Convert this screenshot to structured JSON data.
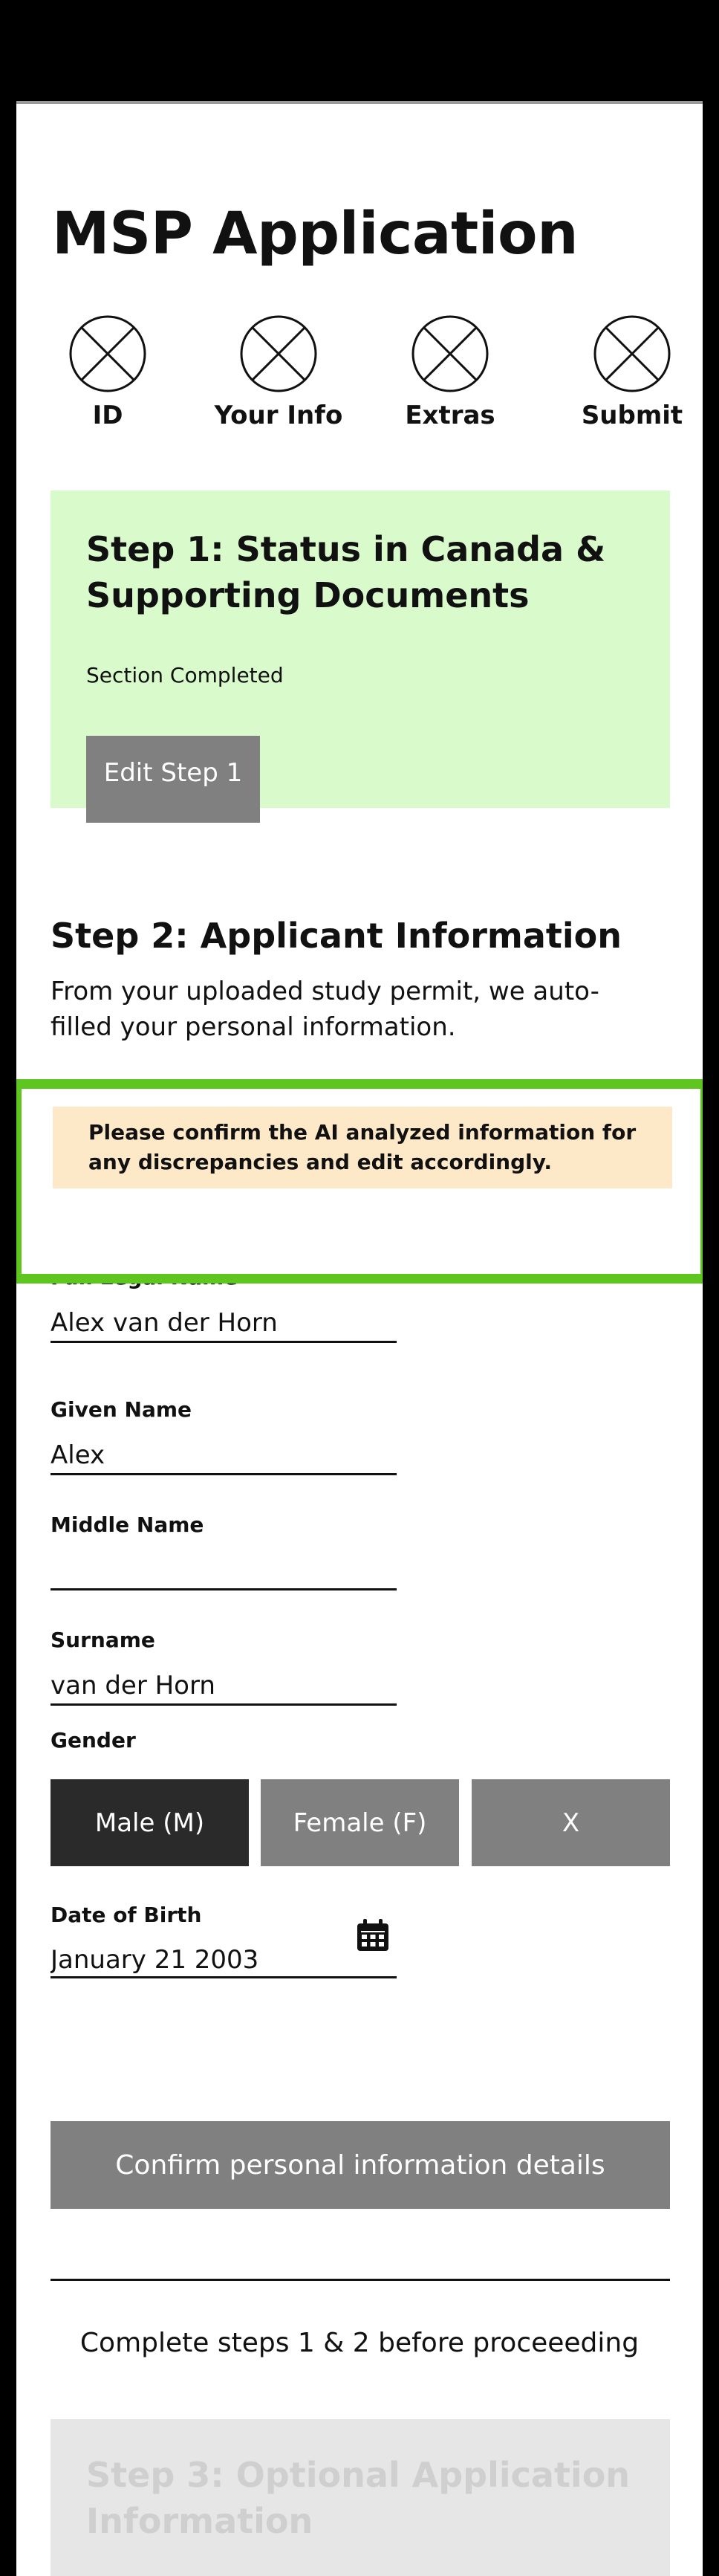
{
  "app": {
    "title": "MSP Application"
  },
  "stepper": {
    "steps": [
      {
        "label": "ID",
        "icon": "x-circle-icon"
      },
      {
        "label": "Your Info",
        "icon": "x-circle-icon"
      },
      {
        "label": "Extras",
        "icon": "x-circle-icon"
      },
      {
        "label": "Submit",
        "icon": "x-circle-icon"
      }
    ]
  },
  "step1": {
    "title": "Step 1: Status in Canada & Supporting Documents",
    "status": "Section Completed",
    "edit_label": "Edit Step 1"
  },
  "step2": {
    "title": "Step 2: Applicant Information",
    "description": "From your uploaded study permit, we auto-filled your personal information.",
    "alert": "Please confirm the AI analyzed information for any discrepancies and edit accordingly.",
    "fields": {
      "full_legal_name": {
        "label": "Full Legal Name",
        "value": "Alex van der Horn"
      },
      "given_name": {
        "label": "Given Name",
        "value": "Alex"
      },
      "middle_name": {
        "label": "Middle Name",
        "value": ""
      },
      "surname": {
        "label": "Surname",
        "value": "van der Horn"
      },
      "date_of_birth": {
        "label": "Date of Birth",
        "value": "January 21 2003"
      }
    },
    "gender": {
      "label": "Gender",
      "options": [
        "Male (M)",
        "Female (F)",
        "X"
      ],
      "selected": "Male (M)"
    },
    "confirm_label": "Confirm personal information details"
  },
  "footer_note": "Complete steps 1 & 2 before proceeeding",
  "step3": {
    "title": "Step 3: Optional Application Information"
  },
  "colors": {
    "completed_bg": "#d9fbcc",
    "alert_bg": "#fde8c8",
    "highlight_border": "#5ec61e",
    "button_gray": "#808080",
    "selected_dark": "#2a2a2a",
    "disabled_bg": "#e6e6e6"
  }
}
